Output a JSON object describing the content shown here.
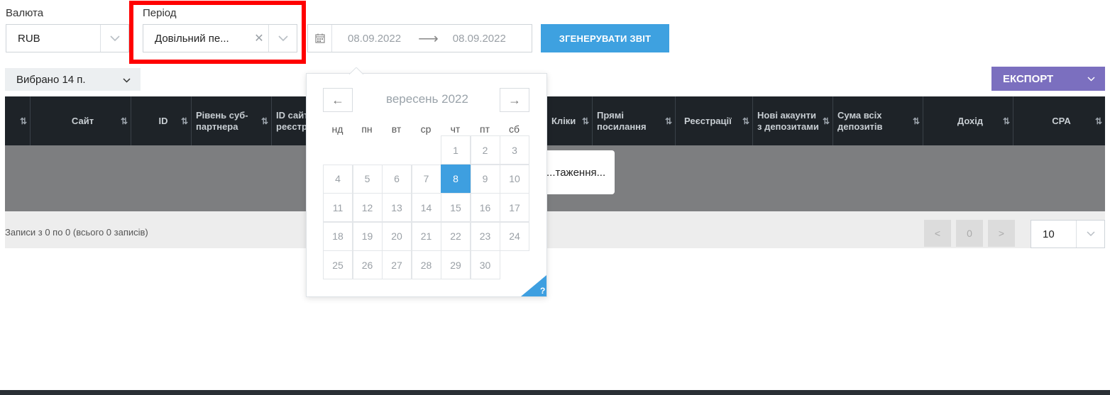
{
  "currency": {
    "label": "Валюта",
    "value": "RUB"
  },
  "period": {
    "label": "Період",
    "value": "Довільний пе..."
  },
  "date_range": {
    "from": "08.09.2022",
    "to": "08.09.2022"
  },
  "generate_button": "ЗГЕНЕРУВАТИ ЗВІТ",
  "columns_selector": "Вибрано 14 п.",
  "export_button": "ЕКСПОРТ",
  "table": {
    "headers": [
      "",
      "Сайт",
      "ID",
      "Рівень суб-партнера",
      "ID сайт реєстр",
      "Кліки",
      "Прямі посилання",
      "Реєстрації",
      "Нові акаунти з депозитами",
      "Сума всіх депозитів",
      "Дохід",
      "CPA"
    ]
  },
  "loading_text": "...таження...",
  "records_info": "Записи з 0 по 0 (всього 0 записів)",
  "pagination": {
    "prev": "<",
    "page": "0",
    "next": ">",
    "page_size": "10"
  },
  "calendar": {
    "title": "вересень 2022",
    "weekdays": [
      "нд",
      "пн",
      "вт",
      "ср",
      "чт",
      "пт",
      "сб"
    ],
    "selected_day": "8",
    "weeks": [
      [
        "",
        "",
        "",
        "",
        "1",
        "2",
        "3"
      ],
      [
        "4",
        "5",
        "6",
        "7",
        "8",
        "9",
        "10"
      ],
      [
        "11",
        "12",
        "13",
        "14",
        "15",
        "16",
        "17"
      ],
      [
        "18",
        "19",
        "20",
        "21",
        "22",
        "23",
        "24"
      ],
      [
        "25",
        "26",
        "27",
        "28",
        "29",
        "30",
        ""
      ]
    ],
    "help": "?"
  }
}
